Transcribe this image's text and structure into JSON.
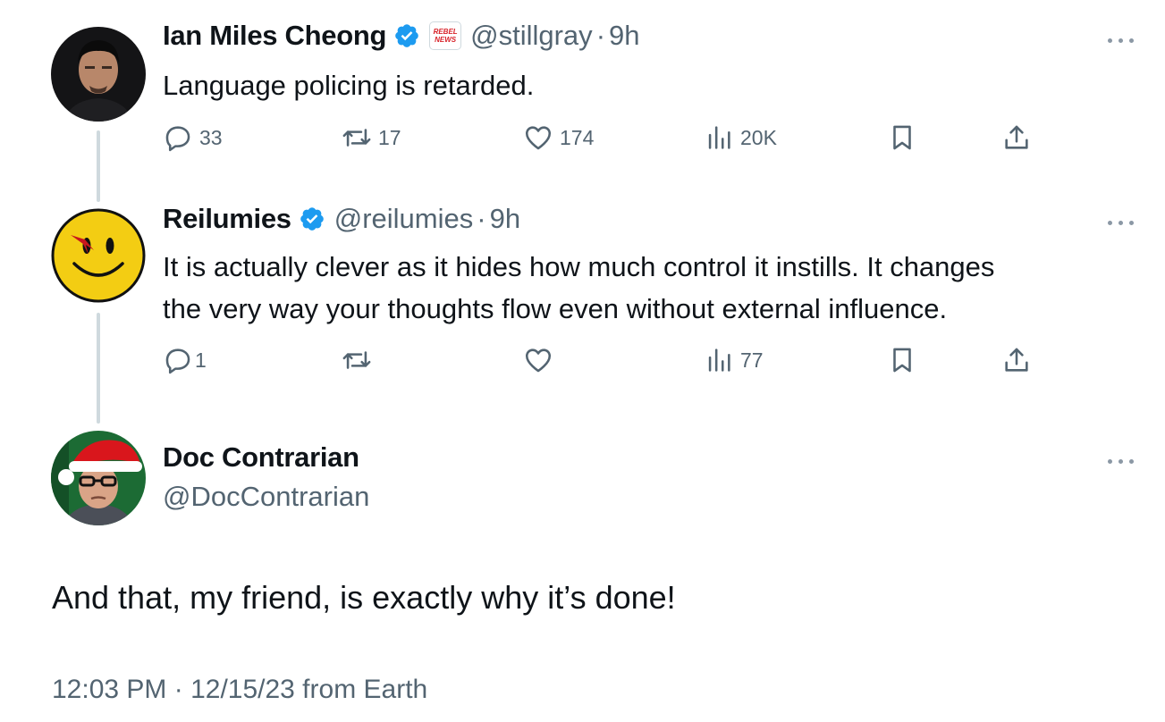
{
  "tweets": [
    {
      "name": "Ian Miles Cheong",
      "handle": "@stillgray",
      "time": "9h",
      "affiliation_badge": "REBEL NEWS",
      "text": "Language policing is retarded.",
      "replies": "33",
      "reposts": "17",
      "likes": "174",
      "views": "20K"
    },
    {
      "name": "Reilumies",
      "handle": "@reilumies",
      "time": "9h",
      "text_line1": "It is actually clever as it hides how much control it instills. It changes",
      "text_line2": "the very way your thoughts flow even without external influence.",
      "replies": "1",
      "reposts": "",
      "likes": "",
      "views": "77"
    }
  ],
  "main_tweet": {
    "name": "Doc Contrarian",
    "handle": "@DocContrarian",
    "text": "And that, my friend, is exactly why it’s done!",
    "meta": "12:03 PM · 12/15/23 from Earth"
  },
  "separator": "·",
  "colors": {
    "text": "#0f1419",
    "secondary": "#536471",
    "verified": "#1d9bf0",
    "thread_line": "#cfd9de"
  },
  "icons": [
    "reply-icon",
    "repost-icon",
    "like-icon",
    "views-icon",
    "bookmark-icon",
    "share-icon",
    "verified-badge-icon",
    "more-icon"
  ]
}
